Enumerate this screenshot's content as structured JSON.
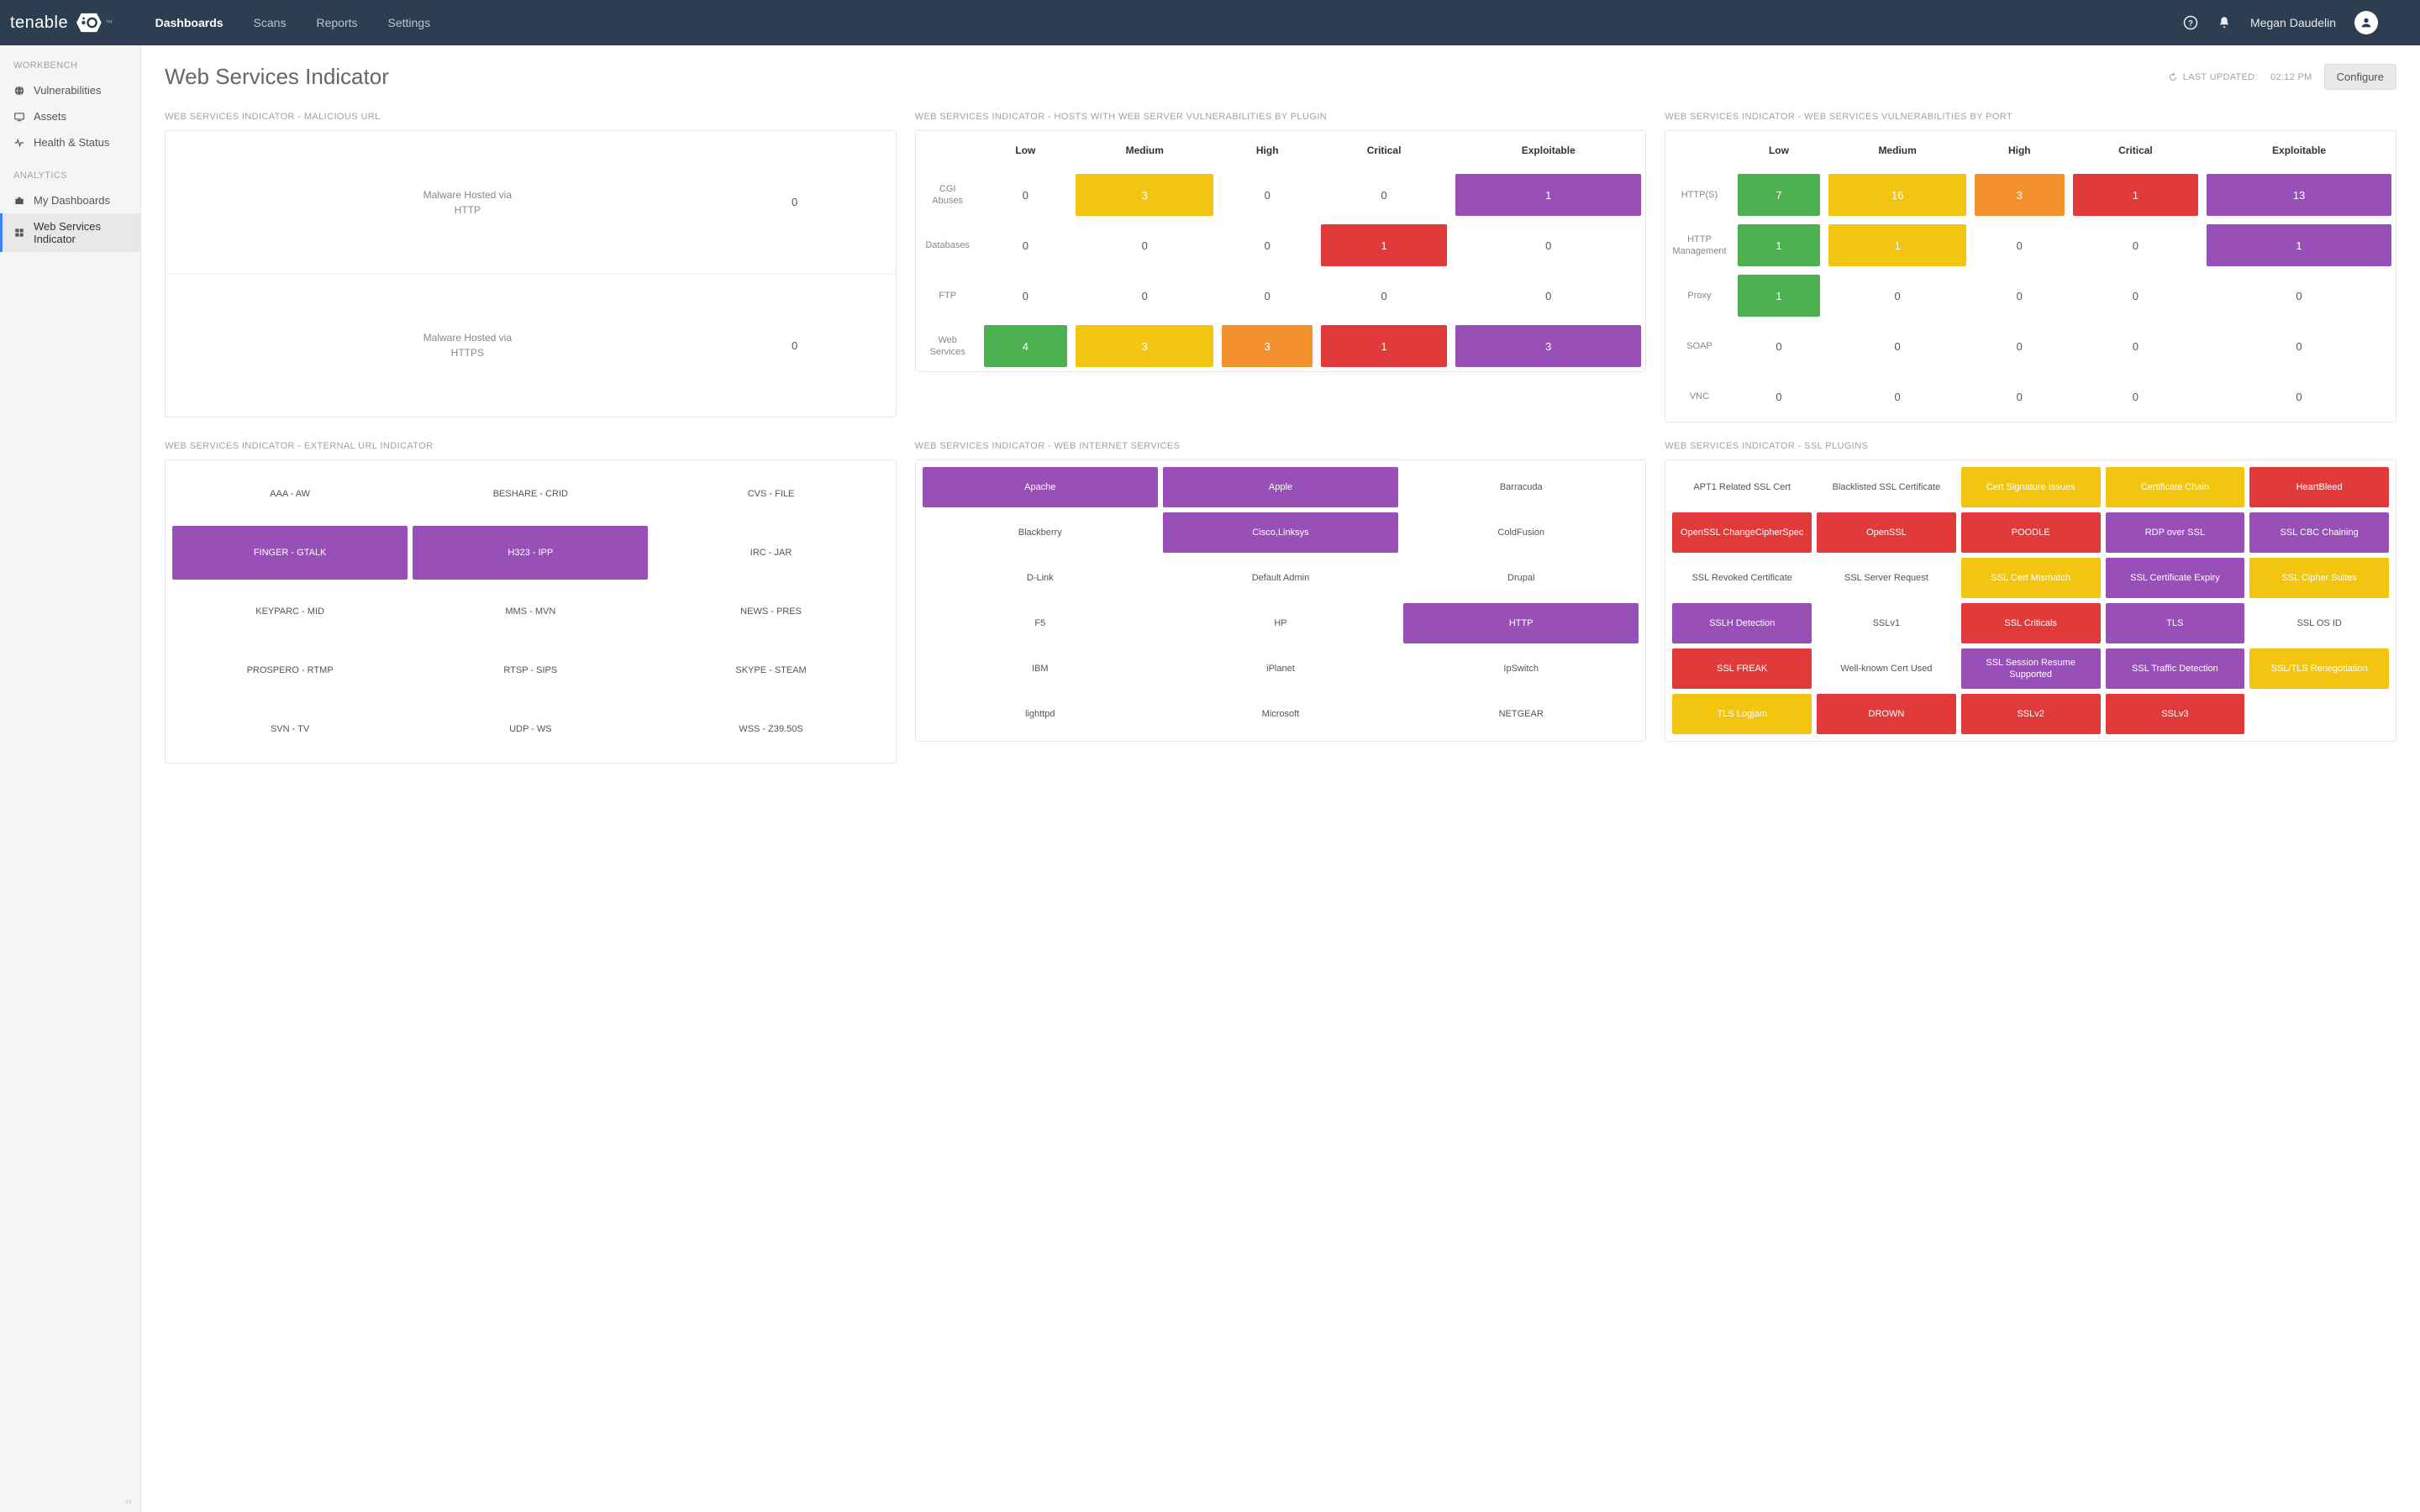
{
  "brand": "tenable",
  "topnav": {
    "items": [
      "Dashboards",
      "Scans",
      "Reports",
      "Settings"
    ],
    "active": 0
  },
  "user": "Megan Daudelin",
  "sidebar": {
    "sections": [
      {
        "label": "WORKBENCH",
        "items": [
          {
            "label": "Vulnerabilities"
          },
          {
            "label": "Assets"
          },
          {
            "label": "Health & Status"
          }
        ]
      },
      {
        "label": "ANALYTICS",
        "items": [
          {
            "label": "My Dashboards"
          },
          {
            "label": "Web Services Indicator",
            "active": true
          }
        ]
      }
    ]
  },
  "page": {
    "title": "Web Services Indicator",
    "last_updated_prefix": "LAST UPDATED:",
    "last_updated_time": "02:12 PM",
    "configure": "Configure"
  },
  "widgets": {
    "malicious": {
      "title": "WEB SERVICES INDICATOR - MALICIOUS URL",
      "rows": [
        {
          "label": "Malware Hosted via HTTP",
          "value": "0"
        },
        {
          "label": "Malware Hosted via HTTPS",
          "value": "0"
        }
      ]
    },
    "hosts": {
      "title": "WEB SERVICES INDICATOR - HOSTS WITH WEB SERVER VULNERABILITIES BY PLUGIN",
      "cols": [
        "Low",
        "Medium",
        "High",
        "Critical",
        "Exploitable"
      ],
      "rows": [
        {
          "label": "CGI Abuses",
          "cells": [
            {
              "v": "0"
            },
            {
              "v": "3",
              "c": "c-yellow"
            },
            {
              "v": "0"
            },
            {
              "v": "0"
            },
            {
              "v": "1",
              "c": "c-purple"
            }
          ]
        },
        {
          "label": "Databases",
          "cells": [
            {
              "v": "0"
            },
            {
              "v": "0"
            },
            {
              "v": "0"
            },
            {
              "v": "1",
              "c": "c-red"
            },
            {
              "v": "0"
            }
          ]
        },
        {
          "label": "FTP",
          "cells": [
            {
              "v": "0"
            },
            {
              "v": "0"
            },
            {
              "v": "0"
            },
            {
              "v": "0"
            },
            {
              "v": "0"
            }
          ]
        },
        {
          "label": "Web Services",
          "cells": [
            {
              "v": "4",
              "c": "c-green"
            },
            {
              "v": "3",
              "c": "c-yellow"
            },
            {
              "v": "3",
              "c": "c-orange"
            },
            {
              "v": "1",
              "c": "c-red"
            },
            {
              "v": "3",
              "c": "c-purple"
            }
          ]
        }
      ]
    },
    "byport": {
      "title": "WEB SERVICES INDICATOR - WEB SERVICES VULNERABILITIES BY PORT",
      "cols": [
        "Low",
        "Medium",
        "High",
        "Critical",
        "Exploitable"
      ],
      "rows": [
        {
          "label": "HTTP(S)",
          "cells": [
            {
              "v": "7",
              "c": "c-green"
            },
            {
              "v": "16",
              "c": "c-yellow"
            },
            {
              "v": "3",
              "c": "c-orange"
            },
            {
              "v": "1",
              "c": "c-red"
            },
            {
              "v": "13",
              "c": "c-purple"
            }
          ]
        },
        {
          "label": "HTTP Management",
          "cells": [
            {
              "v": "1",
              "c": "c-green"
            },
            {
              "v": "1",
              "c": "c-yellow"
            },
            {
              "v": "0"
            },
            {
              "v": "0"
            },
            {
              "v": "1",
              "c": "c-purple"
            }
          ]
        },
        {
          "label": "Proxy",
          "cells": [
            {
              "v": "1",
              "c": "c-green"
            },
            {
              "v": "0"
            },
            {
              "v": "0"
            },
            {
              "v": "0"
            },
            {
              "v": "0"
            }
          ]
        },
        {
          "label": "SOAP",
          "cells": [
            {
              "v": "0"
            },
            {
              "v": "0"
            },
            {
              "v": "0"
            },
            {
              "v": "0"
            },
            {
              "v": "0"
            }
          ]
        },
        {
          "label": "VNC",
          "cells": [
            {
              "v": "0"
            },
            {
              "v": "0"
            },
            {
              "v": "0"
            },
            {
              "v": "0"
            },
            {
              "v": "0"
            }
          ]
        }
      ]
    },
    "external": {
      "title": "WEB SERVICES INDICATOR - EXTERNAL URL INDICATOR",
      "items": [
        {
          "t": "AAA - AW"
        },
        {
          "t": "BESHARE - CRID"
        },
        {
          "t": "CVS - FILE"
        },
        {
          "t": "FINGER - GTALK",
          "c": "c-purple"
        },
        {
          "t": "H323 - IPP",
          "c": "c-purple"
        },
        {
          "t": "IRC - JAR"
        },
        {
          "t": "KEYPARC - MID"
        },
        {
          "t": "MMS - MVN"
        },
        {
          "t": "NEWS - PRES"
        },
        {
          "t": "PROSPERO - RTMP"
        },
        {
          "t": "RTSP - SIPS"
        },
        {
          "t": "SKYPE - STEAM"
        },
        {
          "t": "SVN - TV"
        },
        {
          "t": "UDP - WS"
        },
        {
          "t": "WSS - Z39.50S"
        }
      ]
    },
    "internet": {
      "title": "WEB SERVICES INDICATOR - WEB INTERNET SERVICES",
      "items": [
        {
          "t": "Apache",
          "c": "c-purple"
        },
        {
          "t": "Apple",
          "c": "c-purple"
        },
        {
          "t": "Barracuda"
        },
        {
          "t": "Blackberry"
        },
        {
          "t": "Cisco,Linksys",
          "c": "c-purple"
        },
        {
          "t": "ColdFusion"
        },
        {
          "t": "D-Link"
        },
        {
          "t": "Default Admin"
        },
        {
          "t": "Drupal"
        },
        {
          "t": "F5"
        },
        {
          "t": "HP"
        },
        {
          "t": "HTTP",
          "c": "c-purple"
        },
        {
          "t": "IBM"
        },
        {
          "t": "iPlanet"
        },
        {
          "t": "IpSwitch"
        },
        {
          "t": "lighttpd"
        },
        {
          "t": "Microsoft"
        },
        {
          "t": "NETGEAR"
        }
      ]
    },
    "ssl": {
      "title": "WEB SERVICES INDICATOR - SSL PLUGINS",
      "items": [
        {
          "t": "APT1 Related SSL Cert"
        },
        {
          "t": "Blacklisted SSL Certificate"
        },
        {
          "t": "Cert Signature Issues",
          "c": "c-yellow"
        },
        {
          "t": "Certificate Chain",
          "c": "c-yellow"
        },
        {
          "t": "HeartBleed",
          "c": "c-red"
        },
        {
          "t": "OpenSSL ChangeCipherSpec",
          "c": "c-red"
        },
        {
          "t": "OpenSSL",
          "c": "c-red"
        },
        {
          "t": "POODLE",
          "c": "c-red"
        },
        {
          "t": "RDP over SSL",
          "c": "c-purple"
        },
        {
          "t": "SSL CBC Chaining",
          "c": "c-purple"
        },
        {
          "t": "SSL Revoked Certificate"
        },
        {
          "t": "SSL Server Request"
        },
        {
          "t": "SSL Cert Mismatch",
          "c": "c-yellow"
        },
        {
          "t": "SSL Certificate Expiry",
          "c": "c-purple"
        },
        {
          "t": "SSL Cipher Suites",
          "c": "c-yellow"
        },
        {
          "t": "SSLH Detection",
          "c": "c-purple"
        },
        {
          "t": "SSLv1"
        },
        {
          "t": "SSL Criticals",
          "c": "c-red"
        },
        {
          "t": "TLS",
          "c": "c-purple"
        },
        {
          "t": "SSL OS ID"
        },
        {
          "t": "SSL FREAK",
          "c": "c-red"
        },
        {
          "t": "Well-known Cert Used"
        },
        {
          "t": "SSL Session Resume Supported",
          "c": "c-purple"
        },
        {
          "t": "SSL Traffic Detection",
          "c": "c-purple"
        },
        {
          "t": "SSL/TLS Renegotiation",
          "c": "c-yellow"
        },
        {
          "t": "TLS Logjam",
          "c": "c-yellow"
        },
        {
          "t": "DROWN",
          "c": "c-red"
        },
        {
          "t": "SSLv2",
          "c": "c-red"
        },
        {
          "t": "SSLv3",
          "c": "c-red"
        }
      ]
    }
  }
}
